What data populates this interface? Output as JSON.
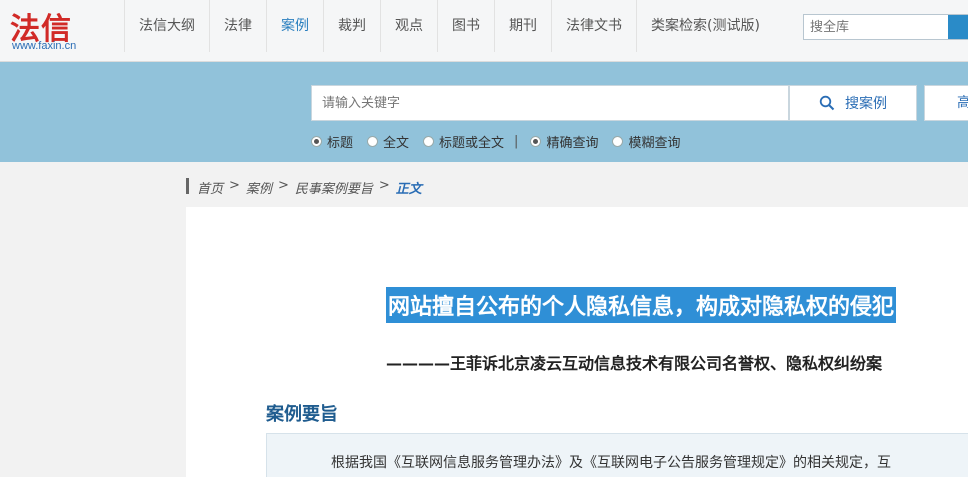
{
  "logo": {
    "main": "法信",
    "sub": "www.faxin.cn"
  },
  "nav": {
    "items": [
      {
        "label": "法信大纲",
        "active": false
      },
      {
        "label": "法律",
        "active": false
      },
      {
        "label": "案例",
        "active": true
      },
      {
        "label": "裁判",
        "active": false
      },
      {
        "label": "观点",
        "active": false
      },
      {
        "label": "图书",
        "active": false
      },
      {
        "label": "期刊",
        "active": false
      },
      {
        "label": "法律文书",
        "active": false
      },
      {
        "label": "类案检索(测试版)",
        "active": false
      }
    ],
    "search_placeholder": "搜全库"
  },
  "search": {
    "placeholder": "请输入关键字",
    "button_label": "搜案例",
    "advanced_label": "高",
    "scope_options": [
      {
        "label": "标题",
        "checked": true
      },
      {
        "label": "全文",
        "checked": false
      },
      {
        "label": "标题或全文",
        "checked": false
      }
    ],
    "divider": "|",
    "mode_options": [
      {
        "label": "精确查询",
        "checked": true
      },
      {
        "label": "模糊查询",
        "checked": false
      }
    ]
  },
  "breadcrumb": {
    "home": "首页",
    "sep": ">",
    "cases": "案例",
    "category": "民事案例要旨",
    "current": "正文"
  },
  "article": {
    "title": "网站擅自公布的个人隐私信息，构成对隐私权的侵犯",
    "subtitle": "————王菲诉北京凌云互动信息技术有限公司名誉权、隐私权纠纷案",
    "section_heading": "案例要旨",
    "summary_text": "根据我国《互联网信息服务管理办法》及《互联网电子公告服务管理规定》的相关规定，互"
  },
  "colors": {
    "brand_red": "#d12a27",
    "accent_blue": "#2a7fbf",
    "band": "#91c2da",
    "highlight": "#2f8fd6"
  }
}
